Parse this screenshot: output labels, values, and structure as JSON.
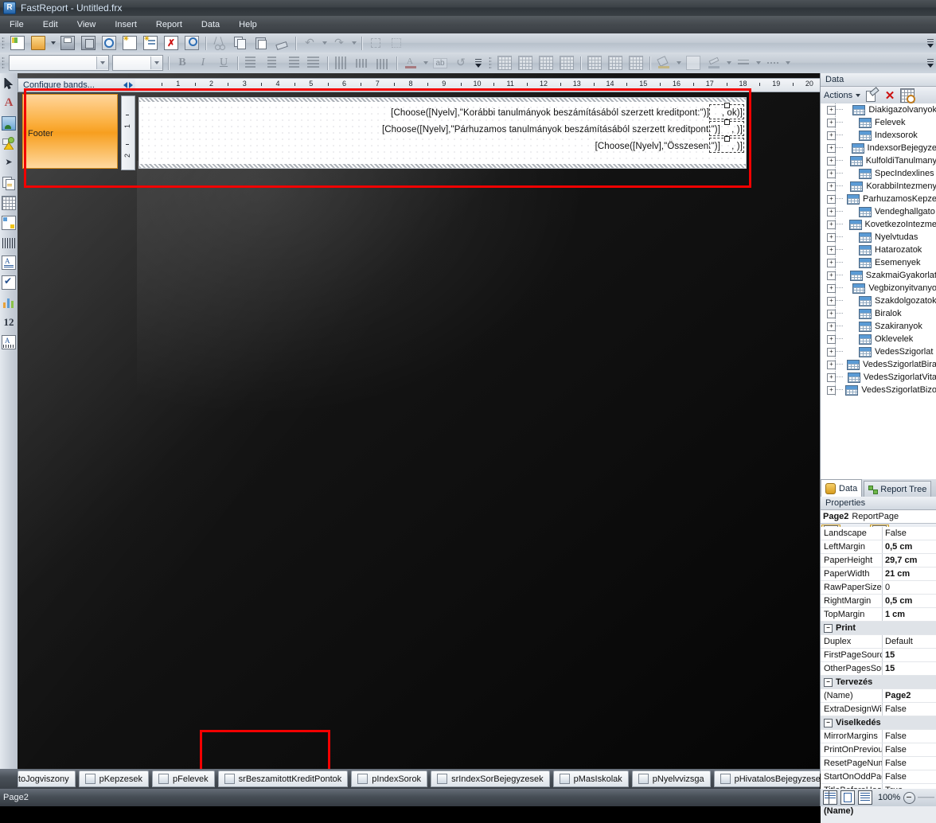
{
  "window": {
    "title": "FastReport - Untitled.frx",
    "logo_icon": "fastreport-logo-icon"
  },
  "menu": {
    "items": [
      "File",
      "Edit",
      "View",
      "Insert",
      "Report",
      "Data",
      "Help"
    ]
  },
  "toolbar_main": {
    "buttons": [
      {
        "name": "new-report-button",
        "icon": "new-report-icon",
        "enabled": true
      },
      {
        "name": "open-report-button",
        "icon": "open-folder-icon",
        "enabled": true
      },
      {
        "name": "open-dropdown-button",
        "icon": "chevron-down-icon",
        "enabled": true
      },
      {
        "name": "save-button",
        "icon": "floppy-save-icon",
        "enabled": true
      },
      {
        "name": "save-all-button",
        "icon": "save-all-icon",
        "enabled": true
      },
      {
        "name": "preview-button",
        "icon": "magnifier-preview-icon",
        "enabled": true
      },
      {
        "name": "new-page-button",
        "icon": "new-page-icon",
        "enabled": true
      },
      {
        "name": "new-dialog-button",
        "icon": "new-dialog-icon",
        "enabled": true
      },
      {
        "name": "delete-page-button",
        "icon": "delete-page-icon",
        "enabled": true
      },
      {
        "name": "page-setup-button",
        "icon": "page-setup-icon",
        "enabled": true
      },
      {
        "name": "cut-button",
        "icon": "scissors-icon",
        "enabled": false
      },
      {
        "name": "copy-button",
        "icon": "copy-icon",
        "enabled": true
      },
      {
        "name": "paste-button",
        "icon": "paste-icon",
        "enabled": true
      },
      {
        "name": "format-painter-button",
        "icon": "paint-brush-icon",
        "enabled": true
      },
      {
        "name": "undo-button",
        "icon": "undo-arrow-icon",
        "enabled": false
      },
      {
        "name": "undo-dropdown-button",
        "icon": "chevron-down-icon",
        "enabled": false
      },
      {
        "name": "redo-button",
        "icon": "redo-arrow-icon",
        "enabled": false
      },
      {
        "name": "redo-dropdown-button",
        "icon": "chevron-down-icon",
        "enabled": false
      },
      {
        "name": "group-button",
        "icon": "group-objects-icon",
        "enabled": false
      },
      {
        "name": "ungroup-button",
        "icon": "ungroup-objects-icon",
        "enabled": false
      }
    ]
  },
  "toolbar_format": {
    "font_name": "",
    "font_size": "",
    "font_name_placeholder": "",
    "buttons": [
      {
        "name": "bold-button",
        "icon": "bold-icon",
        "label": "B",
        "enabled": false
      },
      {
        "name": "italic-button",
        "icon": "italic-icon",
        "label": "I",
        "enabled": false
      },
      {
        "name": "underline-button",
        "icon": "underline-icon",
        "label": "U",
        "enabled": false
      },
      {
        "name": "align-left-button",
        "icon": "align-left-icon",
        "enabled": false
      },
      {
        "name": "align-center-button",
        "icon": "align-center-icon",
        "enabled": false
      },
      {
        "name": "align-right-button",
        "icon": "align-right-icon",
        "enabled": false
      },
      {
        "name": "align-justify-button",
        "icon": "align-justify-icon",
        "enabled": false
      },
      {
        "name": "align-top-button",
        "icon": "align-top-icon",
        "enabled": false
      },
      {
        "name": "align-middle-button",
        "icon": "align-middle-icon",
        "enabled": false
      },
      {
        "name": "align-bottom-button",
        "icon": "align-bottom-icon",
        "enabled": false
      },
      {
        "name": "font-color-button",
        "icon": "font-color-icon",
        "enabled": false
      },
      {
        "name": "font-color-dropdown",
        "icon": "chevron-down-icon",
        "enabled": false
      },
      {
        "name": "text-rotation-button",
        "icon": "ab-text-icon",
        "label": "ab",
        "enabled": false
      },
      {
        "name": "reset-style-button",
        "icon": "reset-circular-arrow-icon",
        "enabled": false
      },
      {
        "name": "table-style-1-button",
        "icon": "table-grid-icon",
        "enabled": false
      },
      {
        "name": "table-style-2-button",
        "icon": "table-grid-icon",
        "enabled": false
      },
      {
        "name": "table-style-3-button",
        "icon": "table-grid-icon",
        "enabled": false
      },
      {
        "name": "table-style-4-button",
        "icon": "table-grid-icon",
        "enabled": false
      },
      {
        "name": "border-cell-button",
        "icon": "border-cell-icon",
        "enabled": false
      },
      {
        "name": "border-all-button",
        "icon": "border-all-icon",
        "enabled": false
      },
      {
        "name": "border-special-button",
        "icon": "border-special-icon",
        "enabled": false
      },
      {
        "name": "fill-color-button",
        "icon": "paint-bucket-icon",
        "enabled": false
      },
      {
        "name": "fill-color-dropdown",
        "icon": "chevron-down-icon",
        "enabled": false
      },
      {
        "name": "no-fill-button",
        "icon": "white-square-icon",
        "enabled": false
      },
      {
        "name": "border-color-button",
        "icon": "pencil-border-icon",
        "enabled": false
      },
      {
        "name": "border-color-dropdown",
        "icon": "chevron-down-icon",
        "enabled": false
      },
      {
        "name": "line-width-button",
        "icon": "line-width-icon",
        "enabled": false
      },
      {
        "name": "line-width-dropdown",
        "icon": "chevron-down-icon",
        "enabled": false
      },
      {
        "name": "line-style-button",
        "icon": "line-style-icon",
        "enabled": false
      },
      {
        "name": "line-style-dropdown",
        "icon": "chevron-down-icon",
        "enabled": false
      }
    ]
  },
  "toolbox": {
    "items": [
      {
        "name": "select-tool",
        "icon": "pointer-arrow-icon",
        "selected": true
      },
      {
        "name": "text-object-tool",
        "icon": "text-a-icon"
      },
      {
        "name": "picture-object-tool",
        "icon": "picture-icon"
      },
      {
        "name": "shape-object-tool",
        "icon": "shape-triangle-icon"
      },
      {
        "name": "line-object-tool",
        "icon": "line-arrow-icon"
      },
      {
        "name": "subreport-object-tool",
        "icon": "subreport-icon"
      },
      {
        "name": "table-object-tool",
        "icon": "table-icon"
      },
      {
        "name": "matrix-object-tool",
        "icon": "matrix-icon"
      },
      {
        "name": "barcode-object-tool",
        "icon": "barcode-icon"
      },
      {
        "name": "richtext-object-tool",
        "icon": "rich-text-icon"
      },
      {
        "name": "checkbox-object-tool",
        "icon": "checkbox-icon"
      },
      {
        "name": "chart-object-tool",
        "icon": "chart-bar-icon"
      },
      {
        "name": "digits-object-tool",
        "icon": "digits-12-icon"
      },
      {
        "name": "zipcode-object-tool",
        "icon": "zipcode-icon"
      }
    ]
  },
  "designer": {
    "bandbar_label": "Configure bands...",
    "band_name": "Footer",
    "hruler_labels": [
      "1",
      "2",
      "3",
      "4",
      "5",
      "6",
      "7",
      "8",
      "9",
      "10",
      "11",
      "12",
      "13",
      "14",
      "15",
      "16",
      "17",
      "18",
      "19",
      "20"
    ],
    "vruler_labels": [
      "1",
      "2"
    ],
    "report_lines": [
      "[Choose([Nyelv],\"Korábbi tanulmányok beszámításából  szerzett kreditpont:\")]",
      "[Choose([Nyelv],\"Párhuzamos tanulmányok beszámításából   szerzett kreditpont:\")]",
      "[Choose([Nyelv],\"Összesen:\")]"
    ],
    "report_tails": [
      ", ok)]",
      ", )]",
      ", )]"
    ]
  },
  "data_panel": {
    "title": "Data",
    "actions_label": "Actions",
    "action_buttons": [
      {
        "name": "edit-datasource-button",
        "icon": "edit-datasource-icon"
      },
      {
        "name": "delete-datasource-button",
        "icon": "red-x-icon"
      },
      {
        "name": "choose-data-button",
        "icon": "choose-data-icon"
      }
    ],
    "tree_items": [
      "Diakigazolvanyok",
      "Felevek",
      "Indexsorok",
      "IndexsorBejegyze",
      "KulfoldiTanulmany",
      "SpecIndexlines",
      "KorabbiIntezmeny",
      "ParhuzamosKepze",
      "Vendeghallgato",
      "KovetkezoIntezme",
      "Nyelvtudas",
      "Hatarozatok",
      "Esemenyek",
      "SzakmaiGyakorlat",
      "Vegbizonyitvanyo",
      "Szakdolgozatok",
      "Biralok",
      "Szakiranyok",
      "Oklevelek",
      "VedesSzigorlat",
      "VedesSzigorlatBira",
      "VedesSzigorlatVita",
      "VedesSzigorlatBizo"
    ],
    "tabs": [
      {
        "label": "Data",
        "icon": "data-cylinder-icon",
        "active": true
      },
      {
        "label": "Report Tree",
        "icon": "report-tree-icon",
        "active": false
      }
    ]
  },
  "properties_panel": {
    "title": "Properties",
    "object_name": "Page2",
    "object_type": "ReportPage",
    "tool_buttons": [
      {
        "name": "categorized-view-button",
        "icon": "categorized-list-icon",
        "active": true
      },
      {
        "name": "alphabetical-sort-button",
        "icon": "sort-az-icon",
        "active": false
      },
      {
        "name": "properties-view-button",
        "icon": "properties-page-icon",
        "active": true
      },
      {
        "name": "events-view-button",
        "icon": "lightning-events-icon",
        "active": false
      }
    ],
    "rows": [
      {
        "type": "prop",
        "key": "Landscape",
        "value": "False",
        "bold": false
      },
      {
        "type": "prop",
        "key": "LeftMargin",
        "value": "0,5 cm",
        "bold": true
      },
      {
        "type": "prop",
        "key": "PaperHeight",
        "value": "29,7 cm",
        "bold": true
      },
      {
        "type": "prop",
        "key": "PaperWidth",
        "value": "21 cm",
        "bold": true
      },
      {
        "type": "prop",
        "key": "RawPaperSize",
        "value": "0",
        "bold": false
      },
      {
        "type": "prop",
        "key": "RightMargin",
        "value": "0,5 cm",
        "bold": true
      },
      {
        "type": "prop",
        "key": "TopMargin",
        "value": "1 cm",
        "bold": true
      },
      {
        "type": "cat",
        "key": "Print",
        "value": ""
      },
      {
        "type": "prop",
        "key": "Duplex",
        "value": "Default",
        "bold": false
      },
      {
        "type": "prop",
        "key": "FirstPageSource",
        "value": "15",
        "bold": true
      },
      {
        "type": "prop",
        "key": "OtherPagesSourc",
        "value": "15",
        "bold": true
      },
      {
        "type": "cat",
        "key": "Tervezés",
        "value": ""
      },
      {
        "type": "prop",
        "key": "(Name)",
        "value": "Page2",
        "bold": true
      },
      {
        "type": "prop",
        "key": "ExtraDesignWidth",
        "value": "False",
        "bold": false
      },
      {
        "type": "cat",
        "key": "Viselkedés",
        "value": ""
      },
      {
        "type": "prop",
        "key": "MirrorMargins",
        "value": "False",
        "bold": false
      },
      {
        "type": "prop",
        "key": "PrintOnPreviousP",
        "value": "False",
        "bold": false
      },
      {
        "type": "prop",
        "key": "ResetPageNumbe",
        "value": "False",
        "bold": false
      },
      {
        "type": "prop",
        "key": "StartOnOddPage",
        "value": "False",
        "bold": false
      },
      {
        "type": "prop",
        "key": "TitleBeforeHeade",
        "value": "True",
        "bold": false
      }
    ],
    "description": "(Name)"
  },
  "page_tabs": {
    "items": [
      {
        "label": "toJogviszony",
        "active": false,
        "clipped": true
      },
      {
        "label": "pKepzesek",
        "active": false
      },
      {
        "label": "pFelevek",
        "active": false
      },
      {
        "label": "srBeszamitottKreditPontok",
        "active": true
      },
      {
        "label": "pIndexSorok",
        "active": false
      },
      {
        "label": "srIndexSorBejegyzesek",
        "active": false
      },
      {
        "label": "pMasIskolak",
        "active": false
      },
      {
        "label": "pNyelvvizsga",
        "active": false
      },
      {
        "label": "pHivatalosBejegyzesek",
        "active": false
      },
      {
        "label": "",
        "active": false
      }
    ],
    "nav_left_icon": "nav-left-arrow-icon",
    "nav_right_icon": "nav-right-arrow-icon"
  },
  "status_bar": {
    "page_label": "Page2",
    "zoom": "100%",
    "view_buttons": [
      {
        "name": "view-side-by-side-button",
        "icon": "view-side-by-side-icon"
      },
      {
        "name": "view-single-page-button",
        "icon": "view-single-page-icon"
      },
      {
        "name": "view-continuous-button",
        "icon": "view-continuous-icon"
      }
    ]
  },
  "annotations": {
    "highlight_color": "#f20000",
    "regions": [
      {
        "name": "footer-band-highlight"
      },
      {
        "name": "active-page-tab-highlight"
      }
    ]
  }
}
